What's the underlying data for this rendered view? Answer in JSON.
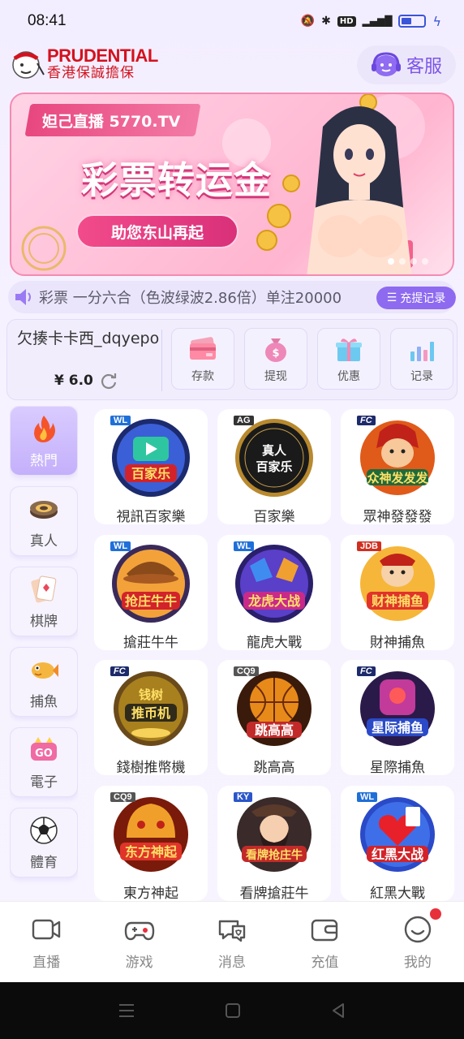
{
  "status": {
    "time": "08:41",
    "hd": "HD",
    "net": "4G"
  },
  "header": {
    "logo_en": "PRUDENTIAL",
    "logo_zh": "香港保誠擔保",
    "service_label": "客服"
  },
  "banner": {
    "tag": "妲己直播 5770.TV",
    "title": "彩票转运金",
    "button": "助您东山再起"
  },
  "marquee": {
    "text": "彩票 一分六合（色波绿波2.86倍）单注20000",
    "record_label": "充提记录"
  },
  "account": {
    "name": "欠揍卡卡西_dqyepo",
    "balance": "¥ 6.0",
    "actions": [
      {
        "label": "存款",
        "icon": "wallet-card-icon"
      },
      {
        "label": "提现",
        "icon": "money-bag-icon"
      },
      {
        "label": "优惠",
        "icon": "gift-icon"
      },
      {
        "label": "记录",
        "icon": "bar-chart-icon"
      }
    ]
  },
  "categories": [
    {
      "label": "熱門",
      "icon": "fire-icon",
      "active": true
    },
    {
      "label": "真人",
      "icon": "chip-icon"
    },
    {
      "label": "棋牌",
      "icon": "cards-icon"
    },
    {
      "label": "捕魚",
      "icon": "fish-icon"
    },
    {
      "label": "電子",
      "icon": "slot-icon"
    },
    {
      "label": "體育",
      "icon": "soccer-ball-icon"
    }
  ],
  "games": [
    {
      "name": "視訊百家樂",
      "provider": "WL",
      "art": "百家乐"
    },
    {
      "name": "百家樂",
      "provider": "AG",
      "art": "真人百家乐"
    },
    {
      "name": "眾神發發發",
      "provider": "FC",
      "art": "众神发发发"
    },
    {
      "name": "搶莊牛牛",
      "provider": "WL",
      "art": "抢庄牛牛"
    },
    {
      "name": "龍虎大戰",
      "provider": "WL",
      "art": "龙虎大战"
    },
    {
      "name": "財神捕魚",
      "provider": "JDB",
      "art": "财神捕鱼"
    },
    {
      "name": "錢樹推幣機",
      "provider": "FC",
      "art": "推币机"
    },
    {
      "name": "跳高高",
      "provider": "CQ9",
      "art": "跳高高"
    },
    {
      "name": "星際捕魚",
      "provider": "FC",
      "art": "星际捕鱼"
    },
    {
      "name": "東方神起",
      "provider": "CQ9",
      "art": "东方神起"
    },
    {
      "name": "看牌搶莊牛",
      "provider": "KY",
      "art": "看牌抢庄牛"
    },
    {
      "name": "紅黑大戰",
      "provider": "WL",
      "art": "红黑大战"
    }
  ],
  "tabs": [
    {
      "label": "直播",
      "icon": "live-camera-icon"
    },
    {
      "label": "游戏",
      "icon": "gamepad-icon"
    },
    {
      "label": "消息",
      "icon": "message-icon"
    },
    {
      "label": "充值",
      "icon": "wallet-icon"
    },
    {
      "label": "我的",
      "icon": "profile-icon",
      "badge": true
    }
  ],
  "colors": {
    "accent": "#8e6af0",
    "brand_red": "#d4121e",
    "banner_pink": "#ffc0d8"
  }
}
